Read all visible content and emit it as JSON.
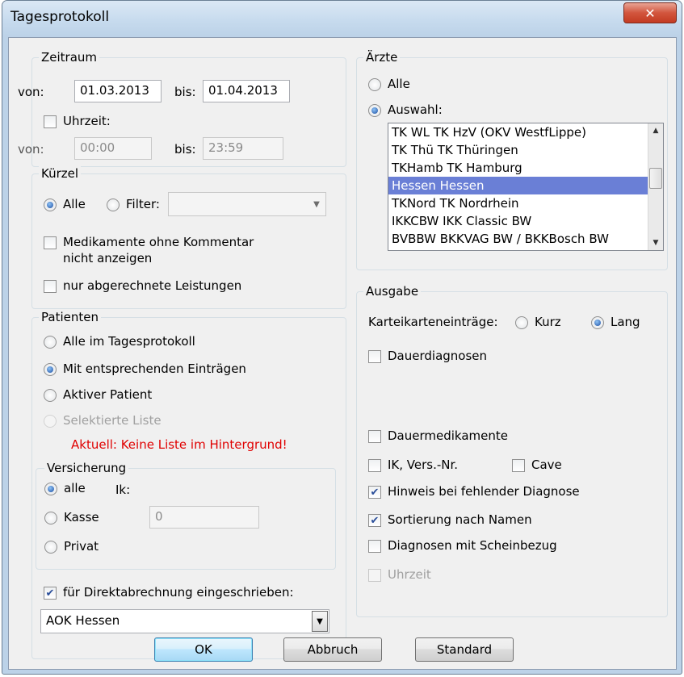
{
  "window": {
    "title": "Tagesprotokoll",
    "close_glyph": "✕"
  },
  "zeitraum": {
    "legend": "Zeitraum",
    "von_label": "von:",
    "von_value": "01.03.2013",
    "bis_label": "bis:",
    "bis_value": "01.04.2013",
    "uhrzeit_label": "Uhrzeit:",
    "uhrzeit_checked": false,
    "time_von_label": "von:",
    "time_von_value": "00:00",
    "time_bis_label": "bis:",
    "time_bis_value": "23:59"
  },
  "kuerzel": {
    "legend": "Kürzel",
    "alle_label": "Alle",
    "filter_label": "Filter:",
    "filter_value": "",
    "medikamente_label_1": "Medikamente ohne Kommentar",
    "medikamente_label_2": "nicht anzeigen",
    "nur_abgerechnete_label": "nur abgerechnete Leistungen"
  },
  "patienten": {
    "legend": "Patienten",
    "option_all": "Alle im Tagesprotokoll",
    "option_entries": "Mit entsprechenden Einträgen",
    "option_active": "Aktiver Patient",
    "option_selected_list": "Selektierte Liste",
    "warning": "Aktuell: Keine Liste im Hintergrund!",
    "versicherung": {
      "legend": "Versicherung",
      "alle_label": "alle",
      "ik_label": "Ik:",
      "kasse_label": "Kasse",
      "kasse_value": "0",
      "privat_label": "Privat"
    },
    "direkt_label": "für Direktabrechnung eingeschrieben:",
    "direkt_checked": true,
    "direkt_value": "AOK Hessen"
  },
  "aerzte": {
    "legend": "Ärzte",
    "alle_label": "Alle",
    "auswahl_label": "Auswahl:",
    "items": [
      "TK WL  TK HzV (OKV WestfLippe)",
      "TK Thü TK Thüringen",
      "TKHamb TK Hamburg",
      "Hessen Hessen",
      "TKNord TK Nordrhein",
      "IKKCBW IKK Classic BW",
      "BVBBW  BKKVAG BW / BKKBosch BW"
    ],
    "selected_index": 3
  },
  "ausgabe": {
    "legend": "Ausgabe",
    "kartei_label": "Karteikarteneinträge:",
    "kurz_label": "Kurz",
    "lang_label": "Lang",
    "dauerdiagnosen_label": "Dauerdiagnosen",
    "dauermedikamente_label": "Dauermedikamente",
    "ik_label": "IK, Vers.-Nr.",
    "cave_label": "Cave",
    "hinweis_label": "Hinweis bei fehlender Diagnose",
    "sortierung_label": "Sortierung nach Namen",
    "diagnosen_label": "Diagnosen mit Scheinbezug",
    "uhrzeit_label": "Uhrzeit"
  },
  "buttons": {
    "ok": "OK",
    "abbruch": "Abbruch",
    "standard": "Standard"
  },
  "glyphs": {
    "check": "✔",
    "combo_arrow": "▼",
    "scroll_up": "▲",
    "scroll_down": "▼"
  },
  "colors": {
    "titlebar": "#bcd2e8",
    "close": "#c33b22",
    "selection": "#6a7fd6",
    "warning": "#e00000"
  }
}
